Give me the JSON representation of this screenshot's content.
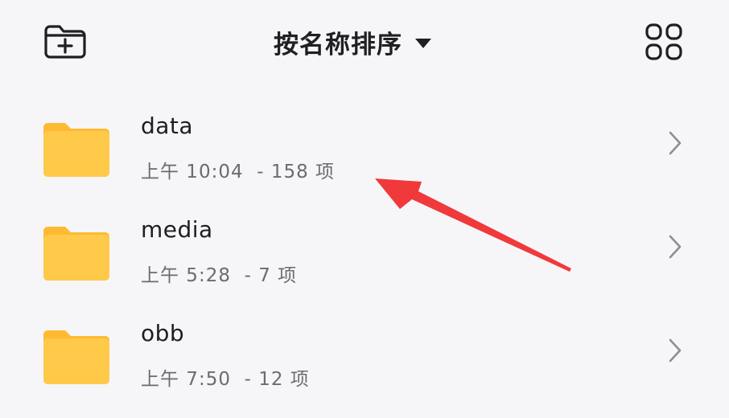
{
  "toolbar": {
    "new_folder_icon": "folder-plus-icon",
    "sort_label": "按名称排序",
    "sort_caret_icon": "caret-down-icon",
    "view_toggle_icon": "grid-view-icon"
  },
  "folders": [
    {
      "name": "data",
      "time": "上午 10:04",
      "count": "158 项"
    },
    {
      "name": "media",
      "time": "上午 5:28",
      "count": "7 项"
    },
    {
      "name": "obb",
      "time": "上午 7:50",
      "count": "12 项"
    }
  ],
  "colors": {
    "folder": "#ffc94a",
    "folder_tab": "#ffba33",
    "annotation_arrow": "#f0393b",
    "background": "#f6f6f8"
  },
  "icons": {
    "folder": "folder-icon",
    "chevron": "chevron-right-icon",
    "annotation": "red-arrow-annotation"
  }
}
